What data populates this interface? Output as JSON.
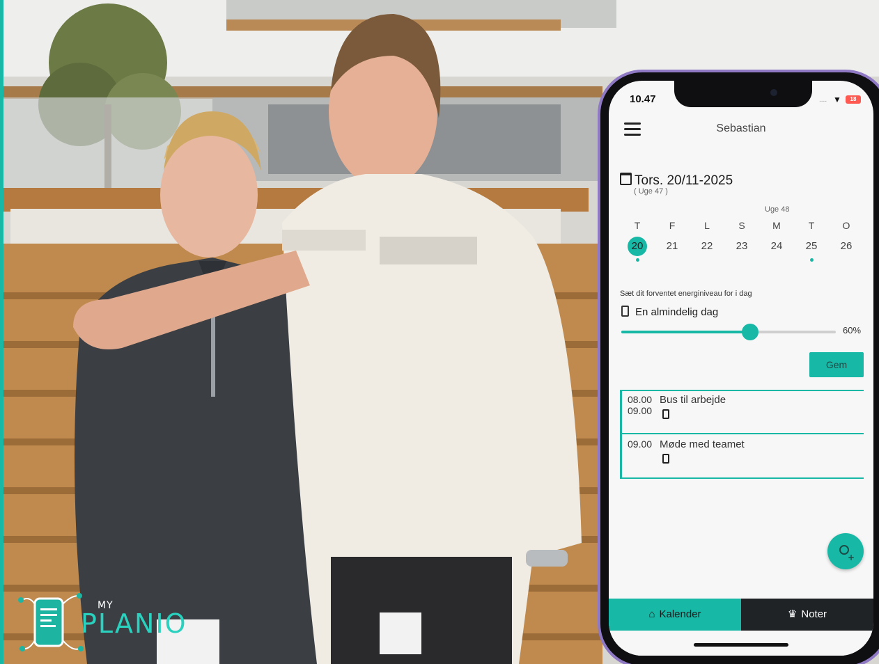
{
  "brand": {
    "my": "MY",
    "name": "PLANIO"
  },
  "status_bar": {
    "time": "10.47",
    "signal": "....",
    "battery": "18"
  },
  "header": {
    "title": "Sebastian"
  },
  "date": {
    "current": "Tors. 20/11-2025",
    "week_sub": "( Uge 47 )",
    "next_week_label": "Uge 48"
  },
  "days": [
    {
      "letter": "T",
      "num": "20",
      "selected": true,
      "dot": true
    },
    {
      "letter": "F",
      "num": "21",
      "selected": false,
      "dot": false
    },
    {
      "letter": "L",
      "num": "22",
      "selected": false,
      "dot": false
    },
    {
      "letter": "S",
      "num": "23",
      "selected": false,
      "dot": false
    },
    {
      "letter": "M",
      "num": "24",
      "selected": false,
      "dot": false
    },
    {
      "letter": "T",
      "num": "25",
      "selected": false,
      "dot": true
    },
    {
      "letter": "O",
      "num": "26",
      "selected": false,
      "dot": false
    }
  ],
  "energy": {
    "prompt": "Sæt dit forventet energiniveau for i dag",
    "value_label": "En almindelig dag",
    "level": 0.6,
    "percent_label": "60%",
    "save_label": "Gem"
  },
  "events": [
    {
      "start": "08.00",
      "end": "09.00",
      "title": "Bus til arbejde"
    },
    {
      "start": "09.00",
      "end": "",
      "title": "Møde med teamet"
    }
  ],
  "tabs": {
    "calendar_label": "Kalender",
    "notes_label": "Noter",
    "calendar_icon": "home-icon",
    "notes_icon": "crown-icon"
  },
  "colors": {
    "accent": "#18b8a6",
    "phone_frame": "#8f79c4",
    "tab_dark": "#202326"
  }
}
